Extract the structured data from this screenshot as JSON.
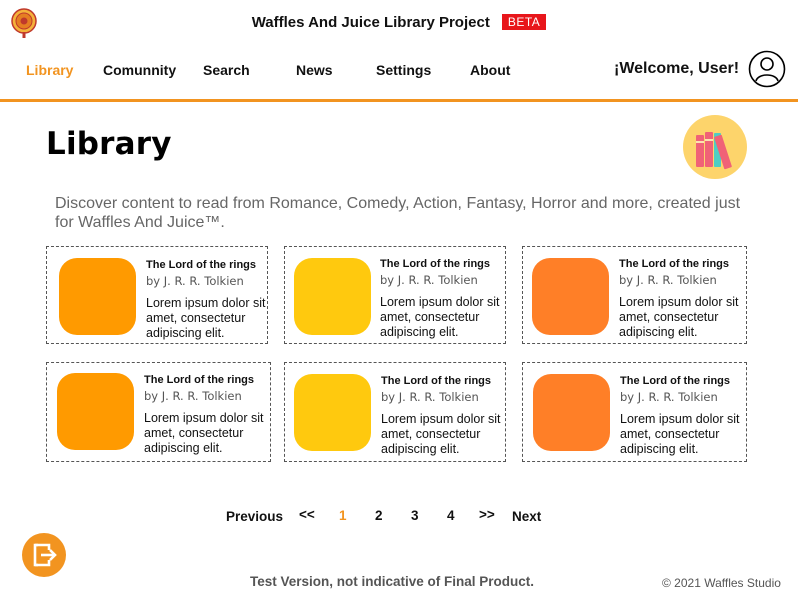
{
  "header": {
    "title": "Waffles And Juice Library Project",
    "badge": "BETA",
    "welcome": "¡Welcome, User!"
  },
  "nav": {
    "items": [
      "Library",
      "Comunnity",
      "Search",
      "News",
      "Settings",
      "About"
    ],
    "active": "Library"
  },
  "page": {
    "title": "Library",
    "intro": "Discover content to read from Romance, Comedy, Action, Fantasy, Horror and more, created just for Waffles And Juice™."
  },
  "cards": [
    {
      "title": "The Lord of the rings",
      "author": "by J. R. R. Tolkien",
      "desc": "Lorem ipsum dolor sit amet, consectetur adipiscing elit.",
      "color": "#ff9a00"
    },
    {
      "title": "The Lord of the rings",
      "author": "by J. R. R. Tolkien",
      "desc": "Lorem ipsum dolor sit amet, consectetur adipiscing elit.",
      "color": "#ffc90e"
    },
    {
      "title": "The Lord of the rings",
      "author": "by J. R. R. Tolkien",
      "desc": "Lorem ipsum dolor sit amet, consectetur adipiscing elit.",
      "color": "#ff7f27"
    },
    {
      "title": "The Lord of the rings",
      "author": "by J. R. R. Tolkien",
      "desc": "Lorem ipsum dolor sit amet, consectetur adipiscing elit.",
      "color": "#ff9a00"
    },
    {
      "title": "The Lord of the rings",
      "author": "by J. R. R. Tolkien",
      "desc": "Lorem ipsum dolor sit amet, consectetur adipiscing elit.",
      "color": "#ffc90e"
    },
    {
      "title": "The Lord of the rings",
      "author": "by J. R. R. Tolkien",
      "desc": "Lorem ipsum dolor sit amet, consectetur adipiscing elit.",
      "color": "#ff7f27"
    }
  ],
  "pagination": {
    "previous": "Previous",
    "first": "<<",
    "pages": [
      "1",
      "2",
      "3",
      "4"
    ],
    "current": "1",
    "last": ">>",
    "next": "Next"
  },
  "footer": {
    "note": "Test Version, not indicative of Final Product.",
    "copyright": "© 2021 Waffles Studio"
  },
  "colors": {
    "accent": "#f29420",
    "beta_bg": "#e8161b"
  },
  "icons": {
    "logo": "library-seal-icon",
    "avatar": "user-avatar-icon",
    "library": "books-icon",
    "exit": "exit-icon"
  }
}
